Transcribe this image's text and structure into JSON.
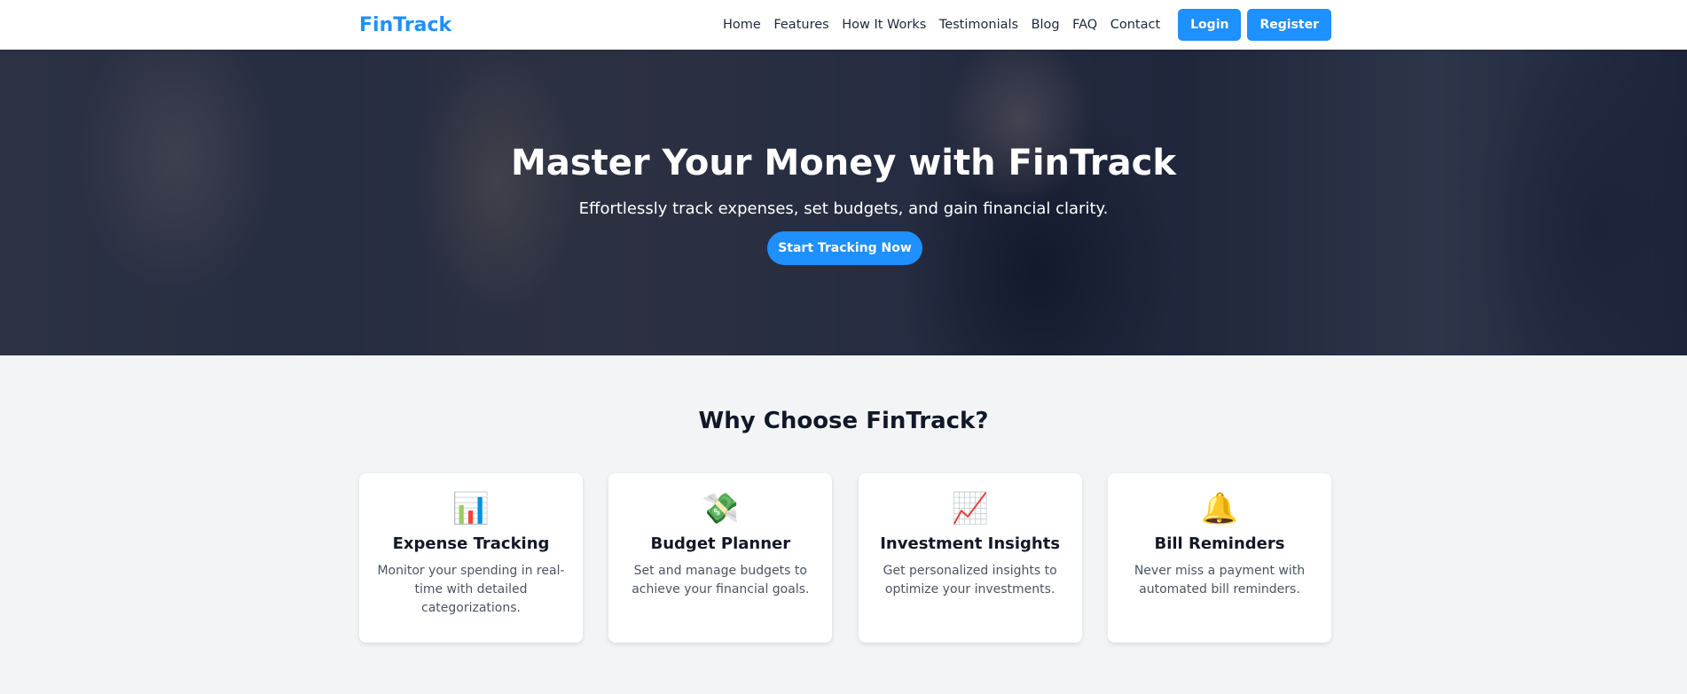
{
  "navbar": {
    "brand": "FinTrack",
    "links": [
      "Home",
      "Features",
      "How It Works",
      "Testimonials",
      "Blog",
      "FAQ",
      "Contact"
    ],
    "login_label": "Login",
    "register_label": "Register"
  },
  "hero": {
    "title": "Master Your Money with FinTrack",
    "subtitle": "Effortlessly track expenses, set budgets, and gain financial clarity.",
    "cta_label": "Start Tracking Now"
  },
  "features": {
    "title": "Why Choose FinTrack?",
    "cards": [
      {
        "icon": "📊",
        "icon_name": "bar-chart-icon",
        "title": "Expense Tracking",
        "description": "Monitor your spending in real-time with detailed categorizations."
      },
      {
        "icon": "💸",
        "icon_name": "money-with-wings-icon",
        "title": "Budget Planner",
        "description": "Set and manage budgets to achieve your financial goals."
      },
      {
        "icon": "📈",
        "icon_name": "chart-increasing-icon",
        "title": "Investment Insights",
        "description": "Get personalized insights to optimize your investments."
      },
      {
        "icon": "🔔",
        "icon_name": "bell-icon",
        "title": "Bill Reminders",
        "description": "Never miss a payment with automated bill reminders."
      }
    ]
  },
  "colors": {
    "accent": "#1e90ff",
    "page_background": "#f3f4f6",
    "card_background": "#ffffff",
    "hero_overlay": "#141c32"
  }
}
